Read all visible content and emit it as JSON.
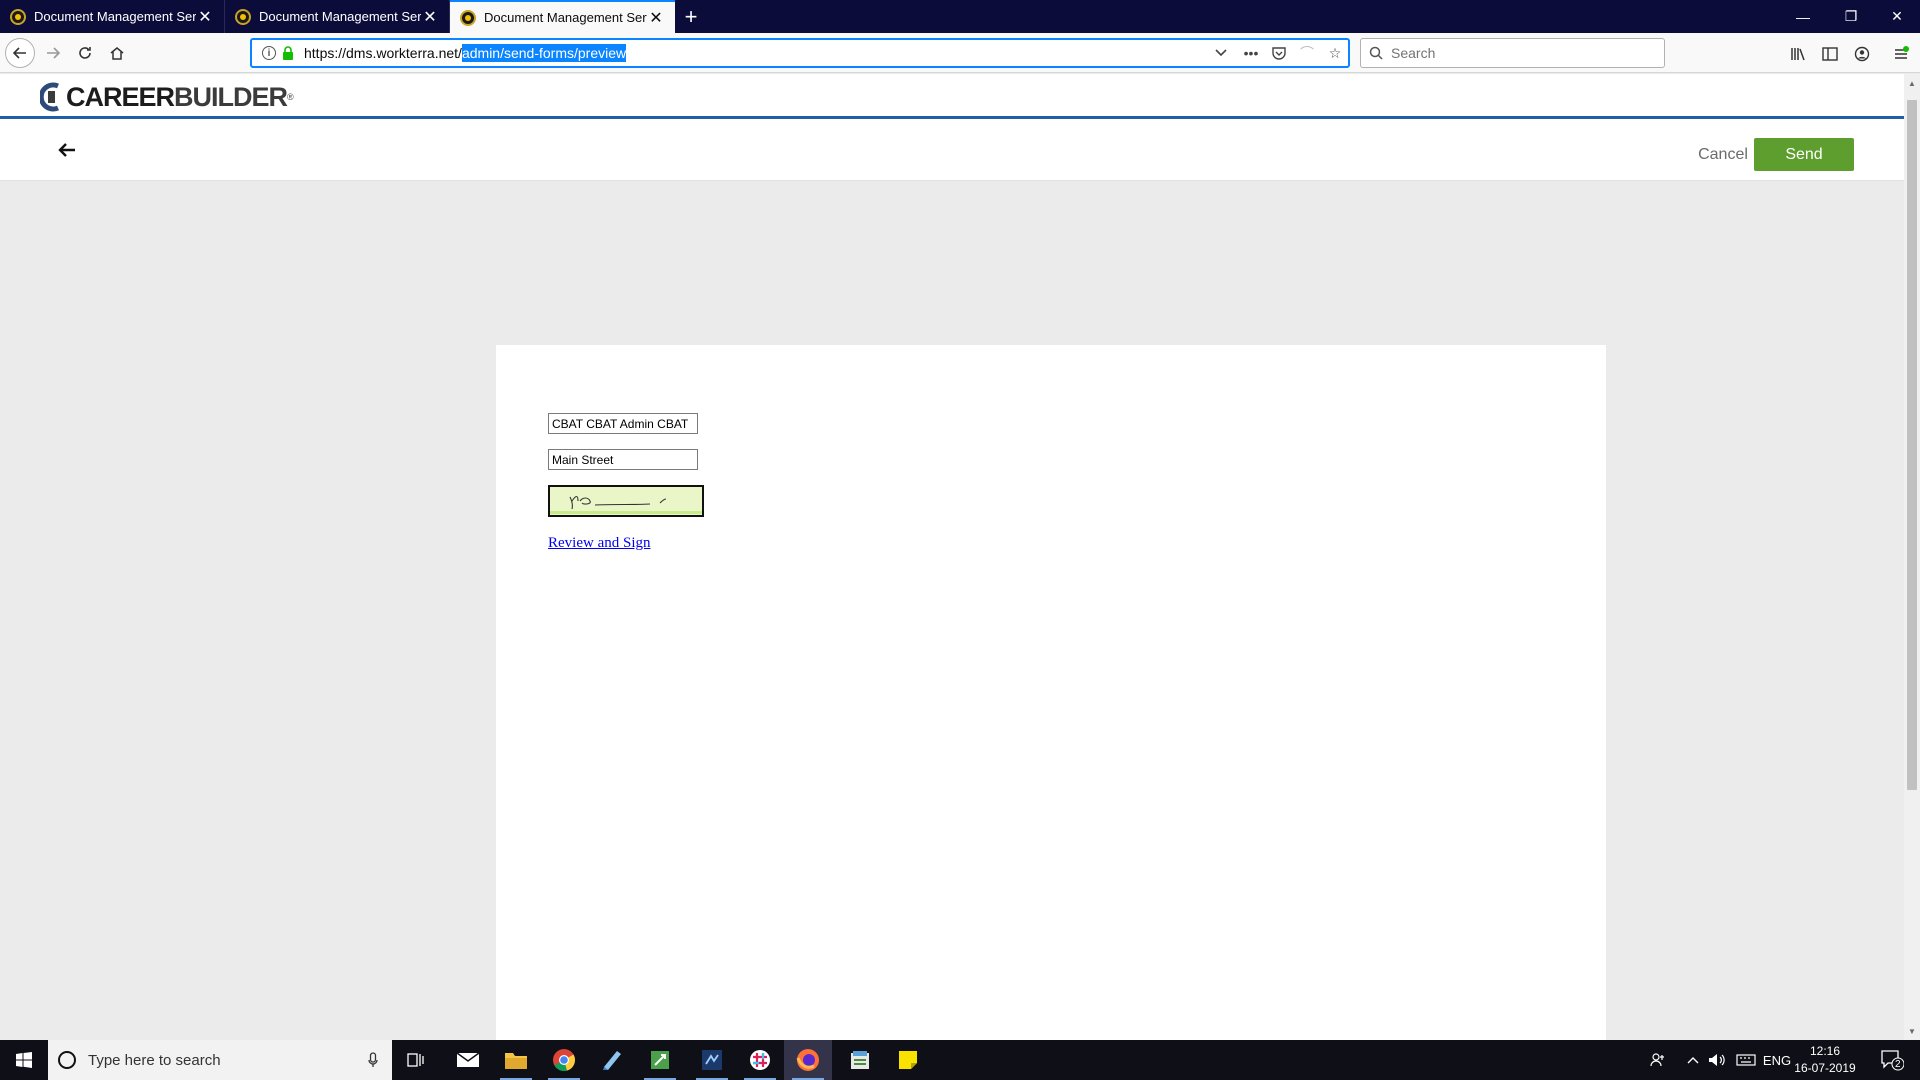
{
  "browser": {
    "tabs": [
      {
        "title": "Document Management Servic",
        "active": false
      },
      {
        "title": "Document Management Servic",
        "active": false
      },
      {
        "title": "Document Management Servic",
        "active": true
      }
    ],
    "new_tab_glyph": "+",
    "url_host": "https://dms.workterra.net/",
    "url_path": "admin/send-forms/preview",
    "search_placeholder": "Search",
    "window_controls": {
      "minimize": "—",
      "restore": "❐",
      "close": "✕"
    }
  },
  "app": {
    "logo_text_a": "CAREER",
    "logo_text_b": "BUILDER",
    "logo_mark": "®",
    "cancel_label": "Cancel",
    "send_label": "Send",
    "accent_color": "#5d9e2e",
    "header_line_color": "#1f5fa8"
  },
  "document": {
    "fields": [
      {
        "value": "CBAT CBAT Admin CBAT"
      },
      {
        "value": "Main Street"
      }
    ],
    "review_link": "Review and Sign"
  },
  "taskbar": {
    "search_placeholder": "Type here to search",
    "language": "ENG",
    "time": "12:16",
    "date": "16-07-2019",
    "notification_count": "2"
  }
}
